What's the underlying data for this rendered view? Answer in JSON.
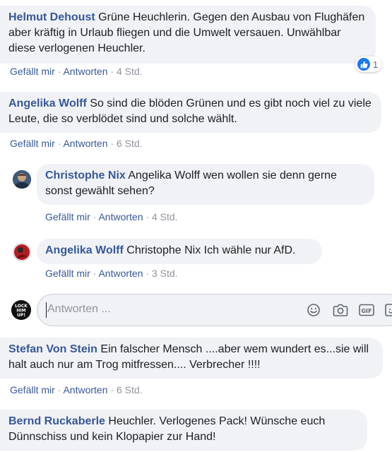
{
  "comments": [
    {
      "author": "Helmut Dehoust",
      "text": "Grüne Heuchlerin. Gegen den Ausbau von Flughäfen aber kräftig in Urlaub fliegen und die Umwelt versauen. Unwählbar diese verlogenen Heuchler.",
      "like": "Gefällt mir",
      "reply": "Antworten",
      "time": "4 Std.",
      "reaction_count": "1"
    },
    {
      "author": "Angelika Wolff",
      "text": "So sind die blöden Grünen und es gibt noch viel zu viele Leute, die so verblödet sind und solche wählt.",
      "like": "Gefällt mir",
      "reply": "Antworten",
      "time": "6 Std."
    },
    {
      "author": "Stefan Von Stein",
      "text": "Ein falscher Mensch ....aber wem wundert es...sie will halt auch nur am Trog mitfressen.... Verbrecher !!!!",
      "like": "Gefällt mir",
      "reply": "Antworten",
      "time": "6 Std."
    },
    {
      "author": "Bernd Ruckaberle",
      "text": "Heuchler. Verlogenes Pack! Wünsche euch Dünnschiss und kein Klopapier zur Hand!"
    }
  ],
  "replies": [
    {
      "author": "Christophe Nix",
      "text": "Angelika Wolff wen wollen sie denn gerne sonst gewählt sehen?",
      "like": "Gefällt mir",
      "reply": "Antworten",
      "time": "4 Std."
    },
    {
      "author": "Angelika Wolff",
      "text": "Christophe Nix Ich wähle nur AfD.",
      "like": "Gefällt mir",
      "reply": "Antworten",
      "time": "3 Std."
    }
  ],
  "reply_input": {
    "placeholder": "Antworten ...",
    "avatar_text": "LOCK HIM UP!"
  },
  "icons": [
    "like-icon",
    "emoji-icon",
    "camera-icon",
    "gif-icon",
    "sticker-icon"
  ],
  "colors": {
    "author_link": "#385898",
    "bubble_bg": "#f0f2f5",
    "meta_gray": "#90949c",
    "like_blue": "#1877f2"
  }
}
